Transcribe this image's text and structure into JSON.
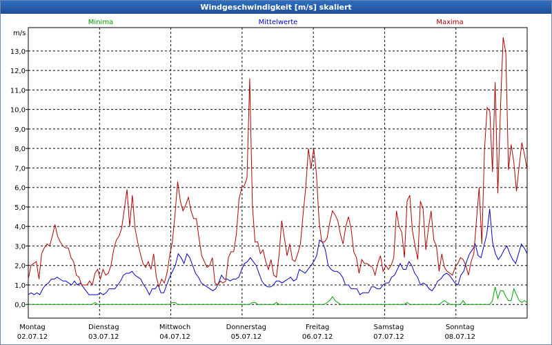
{
  "window": {
    "title": "Windgeschwindigkeit [m/s] skaliert"
  },
  "chart_data": {
    "type": "line",
    "title": "Windgeschwindigkeit [m/s] skaliert",
    "ylabel": "m/s",
    "ylim": [
      -0.7,
      14.2
    ],
    "yticks": [
      "0,0",
      "1,0",
      "2,0",
      "3,0",
      "4,0",
      "5,0",
      "6,0",
      "7,0",
      "8,0",
      "9,0",
      "10,0",
      "11,0",
      "12,0",
      "13,0"
    ],
    "ytick_values": [
      0,
      1,
      2,
      3,
      4,
      5,
      6,
      7,
      8,
      9,
      10,
      11,
      12,
      13
    ],
    "days": [
      {
        "name": "Montag",
        "date": "02.07.12"
      },
      {
        "name": "Dienstag",
        "date": "03.07.12"
      },
      {
        "name": "Mittwoch",
        "date": "04.07.12"
      },
      {
        "name": "Donnerstag",
        "date": "05.07.12"
      },
      {
        "name": "Freitag",
        "date": "06.07.12"
      },
      {
        "name": "Samstag",
        "date": "07.07.12"
      },
      {
        "name": "Sonntag",
        "date": "08.07.12"
      }
    ],
    "grid": true,
    "legend_position": "top",
    "series": [
      {
        "name": "Minima",
        "color": "#00a000",
        "values": [
          0,
          0,
          0,
          0,
          0,
          0,
          0,
          0,
          0,
          0,
          0,
          0,
          0,
          0,
          0,
          0,
          0,
          0,
          0,
          0,
          0,
          0,
          0,
          0,
          0,
          0.1,
          0,
          0,
          0,
          0,
          0,
          0,
          0,
          0,
          0,
          0,
          0,
          0,
          0,
          0,
          0,
          0,
          0,
          0,
          0,
          0,
          0,
          0,
          0,
          0,
          0,
          0,
          0,
          0,
          0.1,
          0.1,
          0,
          0,
          0,
          0,
          0,
          0,
          0,
          0,
          0,
          0,
          0,
          0,
          0,
          0,
          0,
          0,
          0,
          0,
          0,
          0,
          0,
          0,
          0,
          0,
          0,
          0,
          0,
          0,
          0.1,
          0.1,
          0,
          0,
          0,
          0,
          0,
          0,
          0,
          0.1,
          0,
          0,
          0,
          0,
          0,
          0,
          0,
          0,
          0,
          0,
          0,
          0,
          0,
          0,
          0,
          0,
          0,
          0,
          0.1,
          0.2,
          0.4,
          0.2,
          0.1,
          0,
          0,
          0,
          0,
          0,
          0,
          0,
          0,
          0,
          0,
          0,
          0,
          0,
          0,
          0,
          0,
          0,
          0,
          0,
          0,
          0,
          0,
          0,
          0,
          0,
          0.1,
          0,
          0,
          0,
          0,
          0,
          0,
          0,
          0,
          0,
          0,
          0,
          0,
          0.1,
          0.2,
          0.1,
          0,
          0,
          0,
          0,
          0,
          0.2,
          0,
          0,
          0,
          0,
          0,
          0,
          0,
          0,
          0,
          0,
          0.2,
          0.9,
          0.3,
          0.7,
          0.7,
          0.4,
          0.2,
          0.2,
          0.8,
          0.5,
          0.2,
          0.1,
          0.2,
          0.1
        ]
      },
      {
        "name": "Mittelwerte",
        "color": "#0000c8",
        "values": [
          0.5,
          0.6,
          0.5,
          0.6,
          0.5,
          0.8,
          1,
          1.1,
          1.3,
          1.3,
          1.4,
          1.3,
          1.2,
          1.2,
          1.1,
          1,
          1.2,
          1,
          1.1,
          0.9,
          0.7,
          0.5,
          0.5,
          0.5,
          0.5,
          0.6,
          0.5,
          0.6,
          0.8,
          0.8,
          0.8,
          1,
          1.2,
          1.5,
          1.6,
          1.6,
          1.7,
          1.5,
          1.4,
          1.3,
          1,
          0.8,
          0.5,
          0.8,
          0.8,
          1,
          0.6,
          0.6,
          1,
          1.4,
          1.7,
          2,
          2.6,
          2.4,
          2.1,
          2.6,
          2.4,
          2,
          1.6,
          1.4,
          1.1,
          1,
          0.9,
          0.8,
          0.7,
          0.8,
          1.1,
          1.5,
          1.3,
          1.3,
          1.2,
          1.3,
          1.3,
          1.4,
          1.8,
          2.1,
          2.2,
          2.4,
          2.2,
          2,
          1.6,
          1.2,
          1,
          0.9,
          0.9,
          1,
          1.2,
          1.2,
          1.1,
          1.2,
          1.3,
          1.4,
          1.2,
          1.3,
          1.8,
          1.7,
          1.6,
          1.8,
          2,
          2.2,
          2.5,
          3.3,
          3.2,
          2.8,
          2,
          1.8,
          1.7,
          1.7,
          1.6,
          1.4,
          1,
          1,
          0.8,
          0.8,
          0.8,
          0.5,
          0.6,
          0.6,
          0.6,
          0.9,
          0.9,
          0.8,
          0.8,
          1,
          1.1,
          1.1,
          1.4,
          1.5,
          1.8,
          2.1,
          1.8,
          1.8,
          2.2,
          2,
          1.6,
          1.4,
          1,
          1.1,
          1,
          0.8,
          0.7,
          0.9,
          1.2,
          1.3,
          1.5,
          1.6,
          1.5,
          1.3,
          1.1,
          1,
          1.5,
          1.7,
          2.2,
          2.6,
          2.8,
          3.1,
          2.5,
          2.4,
          3,
          3.6,
          4.9,
          3.2,
          2.6,
          2.3,
          2.5,
          2.8,
          3,
          2.6,
          2.3,
          2.1,
          2.6,
          3.1,
          2.9,
          2.6
        ]
      },
      {
        "name": "Maxima",
        "color": "#b00000",
        "values": [
          1.3,
          2,
          2.1,
          2.2,
          1.3,
          2.6,
          2.9,
          3.1,
          3,
          3.5,
          4.1,
          3.5,
          3.2,
          3,
          2.9,
          2.9,
          2.4,
          2.2,
          1.5,
          1.4,
          1,
          1,
          1,
          1.2,
          1,
          1.6,
          1.8,
          1.3,
          1.8,
          1.5,
          1.6,
          2,
          2.8,
          3.3,
          3.5,
          3.9,
          4.9,
          5.9,
          4,
          5.6,
          3.9,
          3.2,
          2.6,
          2.1,
          1.9,
          2.2,
          1.8,
          2.6,
          1.4,
          0.9,
          1.3,
          1.1,
          1.6,
          2.5,
          3.2,
          4.6,
          6.3,
          5.3,
          4.8,
          5.1,
          5.5,
          4.8,
          4.4,
          4.4,
          3.4,
          2.5,
          2.2,
          1.9,
          2,
          2.4,
          1.1,
          1,
          1.2,
          1.1,
          1.2,
          2.4,
          2.7,
          2.7,
          3.6,
          5.4,
          6,
          6.1,
          6.5,
          11.6,
          5.1,
          3.2,
          3.2,
          2.6,
          2.8,
          2.2,
          1.8,
          2.3,
          1.5,
          1.4,
          2.5,
          4.3,
          3.4,
          2.5,
          3.1,
          2.3,
          2.2,
          2.6,
          3.1,
          4.6,
          6,
          8.0,
          7,
          8.0,
          6.7,
          4.3,
          3.2,
          3.2,
          3.4,
          4.2,
          4.8,
          4.6,
          4.3,
          3.6,
          3.1,
          4.0,
          4.5,
          3.9,
          2.7,
          2.4,
          1.6,
          2.3,
          2.1,
          2.1,
          2.0,
          1.9,
          1.5,
          2.1,
          2.5,
          1.7,
          2.0,
          1.8,
          2.0,
          2.4,
          4.8,
          4.0,
          3.7,
          2.4,
          5.3,
          5.6,
          3.8,
          3.0,
          2.3,
          5.3,
          4.9,
          2.8,
          3.9,
          4.8,
          3.3,
          3.0,
          1.7,
          2.6,
          1.9,
          1.7,
          1.6,
          1.5,
          1.9,
          2.1,
          2.4,
          2.3,
          2.0,
          1.5,
          2.2,
          2.6,
          4.3,
          6.0,
          3.1,
          7.9,
          10.1,
          9.9,
          6.8,
          11.4,
          5.7,
          10.0,
          13.7,
          12.9,
          6.9,
          8.2,
          7.3,
          5.8,
          7.1,
          8.3,
          7.7,
          6.9
        ]
      }
    ]
  }
}
